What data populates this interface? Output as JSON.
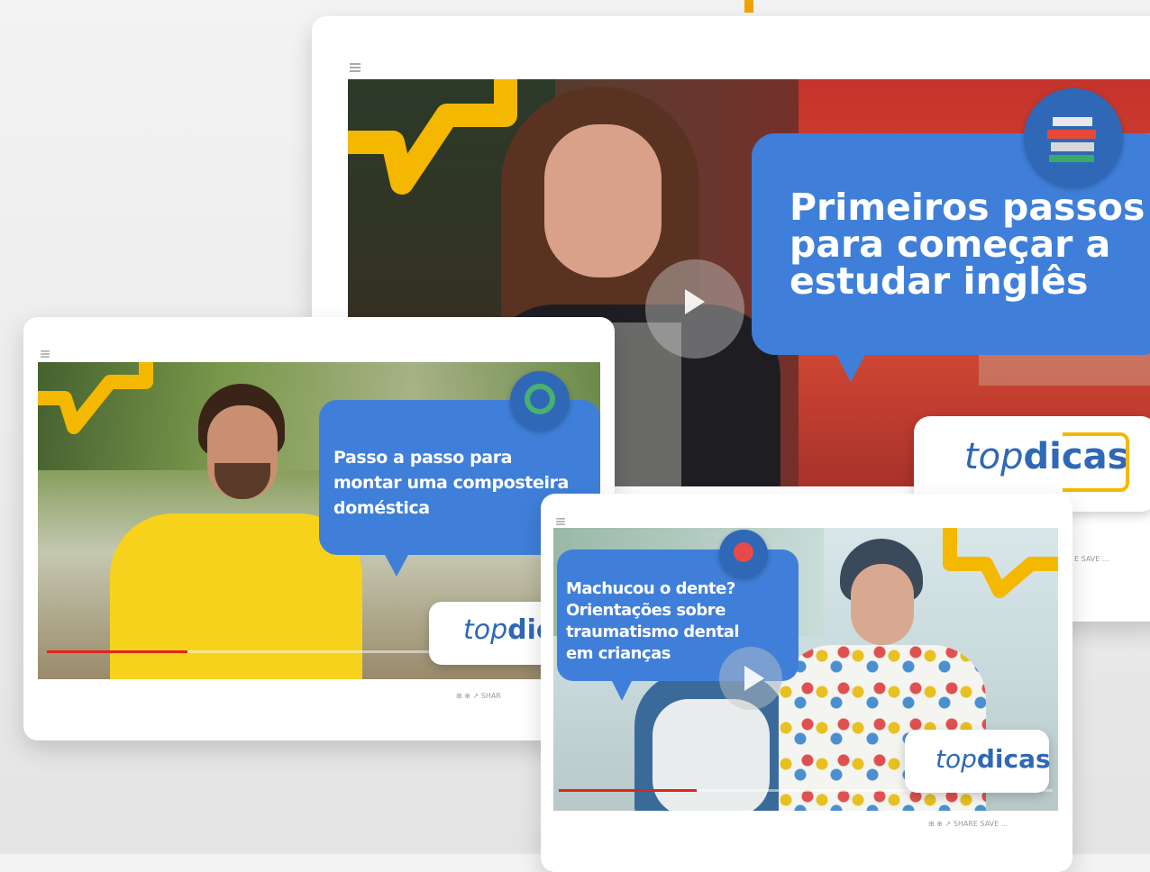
{
  "card_main": {
    "title": "Primeiros passos\npara começar a\nestudar inglês",
    "logo_top": "top",
    "logo_dicas": "dicas",
    "controls_text": "E  SAVE  ...",
    "badge_icon": "books-icon"
  },
  "card_left": {
    "title": "Passo a passo para\nmontar uma composteira\ndoméstica",
    "logo_top": "top",
    "logo_dicas": "dic",
    "controls_text": "⊞  ⊕  ↗  SHAR",
    "badge_icon": "recycle-icon"
  },
  "card_right": {
    "title": "Machucou o dente?\nOrientações sobre\ntraumatismo dental\nem crianças",
    "logo_top": "top",
    "logo_dicas": "dicas",
    "controls_text": "⊞  ⊕  ↗  SHARE  SAVE  ...",
    "badge_icon": "tooth-icon"
  },
  "colors": {
    "brand_blue": "#3f7fd9",
    "brand_yellow": "#f5b800",
    "logo_blue": "#2f68b6"
  }
}
